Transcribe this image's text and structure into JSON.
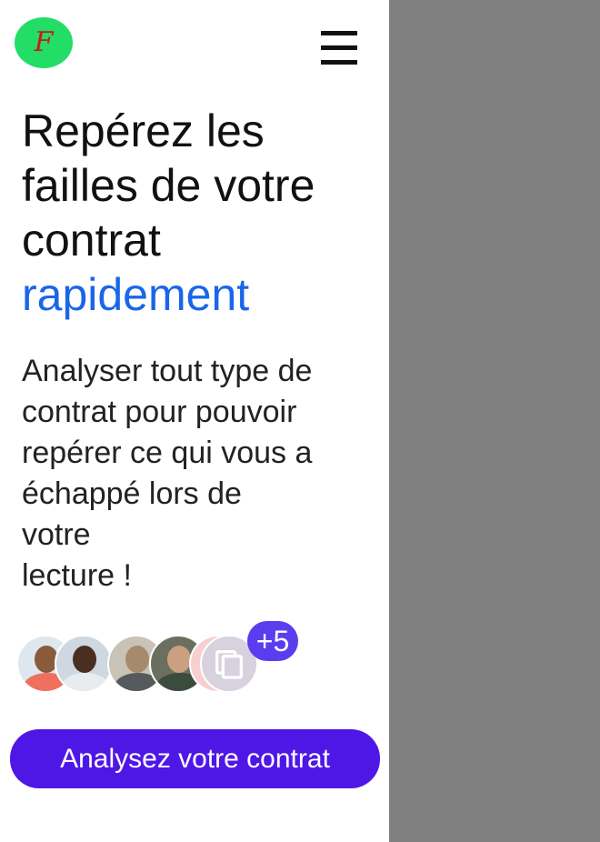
{
  "header": {
    "logo_text": "F",
    "logo_color": "#22dd66",
    "menu_icon": "hamburger-menu-icon"
  },
  "hero": {
    "headline_main": "Repérez les failles de votre contrat",
    "headline_accent": "rapidement",
    "accent_color": "#1a66e8",
    "subtext_lines": [
      "Analyser tout type de",
      "contrat pour pouvoir",
      "repérer ce qui vous a",
      "échappé lors de",
      "votre",
      "lecture !"
    ]
  },
  "social_proof": {
    "avatars": [
      "avatar",
      "avatar",
      "avatar",
      "avatar",
      "avatar",
      "copy-icon"
    ],
    "extra_count": "+5",
    "badge_color": "#5b3df0"
  },
  "cta": {
    "label": "Analysez votre contrat",
    "color": "#4f17e6"
  },
  "side_panel": {
    "color": "#808080"
  }
}
